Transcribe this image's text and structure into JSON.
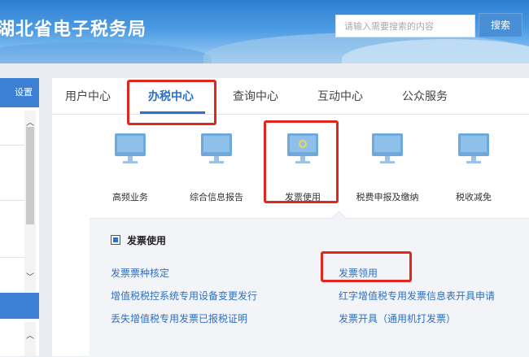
{
  "header": {
    "title": "湖北省电子税务局",
    "search_placeholder": "请输入需要搜索的内容",
    "search_label": "搜索"
  },
  "sidebar": {
    "settings_label": "设置"
  },
  "tabs": [
    {
      "label": "用户中心"
    },
    {
      "label": "办税中心"
    },
    {
      "label": "查询中心"
    },
    {
      "label": "互动中心"
    },
    {
      "label": "公众服务"
    }
  ],
  "services": [
    {
      "label": "高频业务",
      "icon": "monitor-icon"
    },
    {
      "label": "综合信息报告",
      "icon": "monitor-icon"
    },
    {
      "label": "发票使用",
      "icon": "monitor-icon"
    },
    {
      "label": "税费申报及缴纳",
      "icon": "monitor-icon"
    },
    {
      "label": "税收减免",
      "icon": "monitor-icon"
    }
  ],
  "invoice_panel": {
    "title": "发票使用",
    "left_links": [
      "发票票种核定",
      "增值税税控系统专用设备变更发行",
      "丢失增值税专用发票已报税证明"
    ],
    "right_links": [
      "发票领用",
      "红字增值税专用发票信息表开具申请",
      "发票开具（通用机打发票）"
    ]
  },
  "colors": {
    "accent": "#2d6fc9",
    "highlight_box": "#e0271f",
    "link": "#2f6fbf"
  }
}
